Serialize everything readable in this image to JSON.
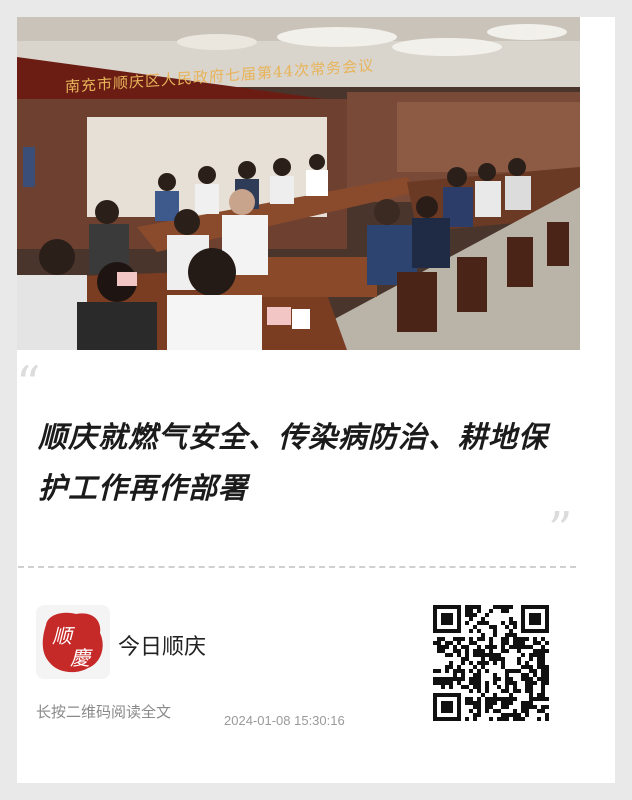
{
  "card": {
    "photo": {
      "banner_text": "南充市顺庆区人民政府七届第44次常务会议",
      "name_plates": [
        "·",
        "·"
      ]
    },
    "headline": "顺庆就燃气安全、传染病防治、耕地保护工作再作部署",
    "quote_open": "“",
    "quote_close": "”",
    "source": {
      "logo_text": "顺慶",
      "name": "今日顺庆"
    },
    "hint": "长按二维码阅读全文",
    "timestamp": "2024-01-08 15:30:16"
  },
  "colors": {
    "logo_red": "#c62a28",
    "banner_gold": "#e8b45a",
    "background": "#e9e9e9"
  }
}
